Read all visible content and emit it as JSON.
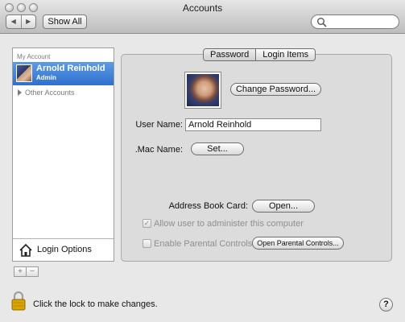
{
  "window": {
    "title": "Accounts"
  },
  "toolbar": {
    "back_icon": "chevron-left-icon",
    "forward_icon": "chevron-right-icon",
    "show_all_label": "Show All",
    "search_placeholder": ""
  },
  "sidebar": {
    "section_heading": "My Account",
    "selected_account": {
      "name": "Arnold Reinhold",
      "role": "Admin"
    },
    "other_accounts_label": "Other Accounts",
    "login_options_label": "Login Options",
    "add_label": "+",
    "remove_label": "−"
  },
  "tabs": [
    {
      "label": "Password",
      "active": true
    },
    {
      "label": "Login Items",
      "active": false
    }
  ],
  "password_pane": {
    "change_password_label": "Change Password...",
    "user_name_label": "User Name:",
    "user_name_value": "Arnold Reinhold",
    "mac_name_label": ".Mac Name:",
    "set_label": "Set...",
    "address_book_label": "Address Book Card:",
    "open_label": "Open...",
    "allow_admin_label": "Allow user to administer this computer",
    "allow_admin_checked": true,
    "parental_controls_label": "Enable Parental Controls",
    "parental_controls_checked": false,
    "open_parental_label": "Open Parental Controls..."
  },
  "footer": {
    "lock_text": "Click the lock to make changes.",
    "help_label": "?"
  },
  "colors": {
    "selection": "#3a7bd5",
    "window_bg": "#e8e8e8",
    "panel_bg": "#dcdcdc"
  }
}
